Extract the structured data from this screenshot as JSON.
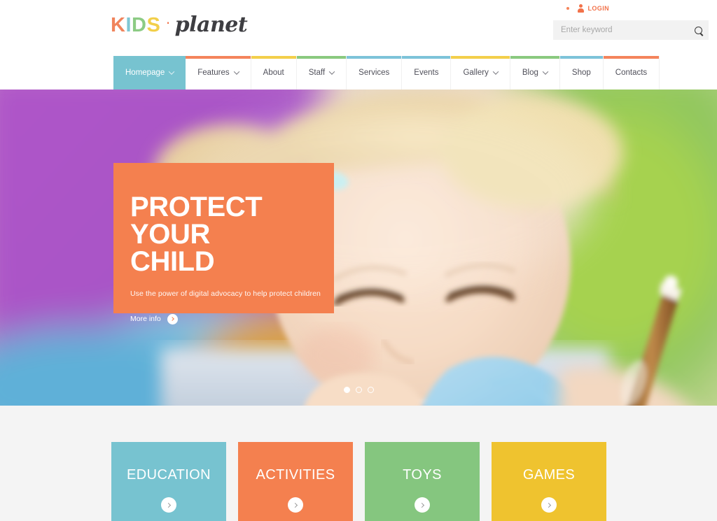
{
  "site": {
    "logo": {
      "kids_letters": [
        {
          "char": "K",
          "color": "#f0845c"
        },
        {
          "char": "I",
          "color": "#7fc7d4"
        },
        {
          "char": "D",
          "color": "#8ccb84"
        },
        {
          "char": "S",
          "color": "#f2cf4a"
        }
      ],
      "separator": "·",
      "word": "planet"
    }
  },
  "topbar": {
    "login_label": "LOGIN",
    "login_icon": "person-icon",
    "bullet_icon": "dot-icon"
  },
  "search": {
    "placeholder": "Enter keyword",
    "value": "",
    "icon": "search-icon"
  },
  "nav": {
    "items": [
      {
        "label": "Homepage",
        "has_dropdown": true,
        "active": true,
        "bar_color": "#77c3d0"
      },
      {
        "label": "Features",
        "has_dropdown": true,
        "active": false,
        "bar_color": "#f4845c"
      },
      {
        "label": "About",
        "has_dropdown": false,
        "active": false,
        "bar_color": "#f3cf4b"
      },
      {
        "label": "Staff",
        "has_dropdown": true,
        "active": false,
        "bar_color": "#8ac97f"
      },
      {
        "label": "Services",
        "has_dropdown": false,
        "active": false,
        "bar_color": "#7dc3d9"
      },
      {
        "label": "Events",
        "has_dropdown": false,
        "active": false,
        "bar_color": "#7dc3d9"
      },
      {
        "label": "Gallery",
        "has_dropdown": true,
        "active": false,
        "bar_color": "#f3cf4b"
      },
      {
        "label": "Blog",
        "has_dropdown": true,
        "active": false,
        "bar_color": "#8ac97f"
      },
      {
        "label": "Shop",
        "has_dropdown": false,
        "active": false,
        "bar_color": "#7dc3d9"
      },
      {
        "label": "Contacts",
        "has_dropdown": false,
        "active": false,
        "bar_color": "#f4845c"
      }
    ]
  },
  "hero": {
    "title_line1": "PROTECT YOUR",
    "title_line2": "CHILD",
    "subtitle": "Use the power of digital advocacy to help protect children",
    "more_label": "More info",
    "more_icon": "chevron-right-icon",
    "caption_bg": "#f4804f",
    "slides": [
      {
        "active": true
      },
      {
        "active": false
      },
      {
        "active": false
      }
    ]
  },
  "categories": [
    {
      "label": "EDUCATION",
      "color": "#77c3d0",
      "icon": "chevron-right-icon"
    },
    {
      "label": "ACTIVITIES",
      "color": "#f4804f",
      "icon": "chevron-right-icon"
    },
    {
      "label": "TOYS",
      "color": "#85c67f",
      "icon": "chevron-right-icon"
    },
    {
      "label": "GAMES",
      "color": "#efc32f",
      "icon": "chevron-right-icon"
    }
  ]
}
